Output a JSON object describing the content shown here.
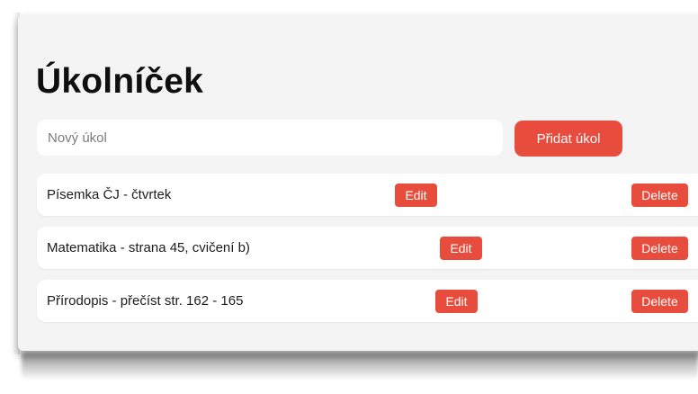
{
  "app": {
    "title": "Úkolníček"
  },
  "new_task": {
    "placeholder": "Nový úkol",
    "value": "",
    "add_label": "Přidat úkol"
  },
  "tasks": [
    {
      "text": "Písemka ČJ - čtvrtek",
      "edit_label": "Edit",
      "delete_label": "Delete"
    },
    {
      "text": "Matematika - strana 45, cvičení b)",
      "edit_label": "Edit",
      "delete_label": "Delete"
    },
    {
      "text": "Přírodopis - přečíst str. 162 - 165",
      "edit_label": "Edit",
      "delete_label": "Delete"
    }
  ],
  "colors": {
    "accent": "#e74c3c",
    "card_background": "#f4f4f4",
    "item_background": "#ffffff"
  }
}
